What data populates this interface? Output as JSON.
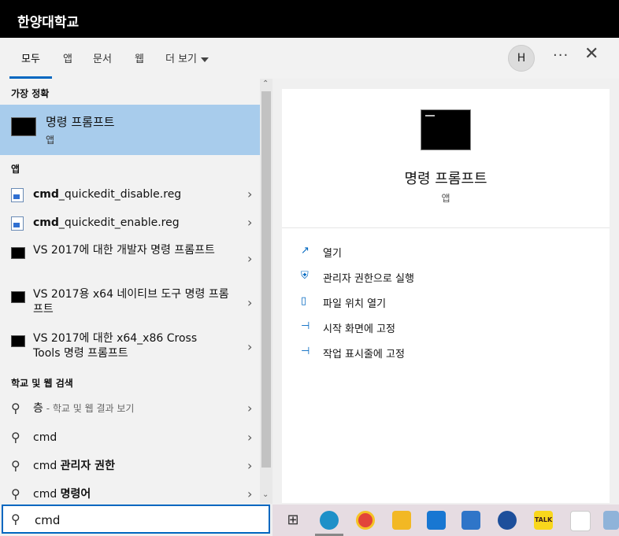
{
  "window": {
    "title": "한양대학교"
  },
  "tabs": [
    "모두",
    "앱",
    "문서",
    "웹",
    "더 보기"
  ],
  "avatar_letter": "H",
  "more_glyph": "···",
  "close_glyph": "✕",
  "sections": {
    "best": "가장 정확",
    "apps": "앱",
    "web": "학교 및 웹 검색"
  },
  "best_match": {
    "name": "명령 프롬프트",
    "type": "앱"
  },
  "apps": [
    {
      "bold": "cmd",
      "rest": "_quickedit_disable.reg"
    },
    {
      "bold": "cmd",
      "rest": "_quickedit_enable.reg"
    },
    {
      "label": "VS 2017에 대한 개발자 명령 프롬프트"
    },
    {
      "label": "VS 2017용 x64 네이티브 도구 명령 프롬프트"
    },
    {
      "label": "VS 2017에 대한 x64_x86 Cross Tools 명령 프롬프트"
    }
  ],
  "web": [
    {
      "main": "층",
      "sub": " - 학교 및 웹 결과 보기"
    },
    {
      "main": "cmd",
      "sub": ""
    },
    {
      "main": "cmd ",
      "bold": "관리자 권한"
    },
    {
      "main": "cmd ",
      "bold": "명령어"
    }
  ],
  "detail": {
    "title": "명령 프롬프트",
    "type": "앱",
    "actions": [
      "열기",
      "관리자 권한으로 실행",
      "파일 위치 열기",
      "시작 화면에 고정",
      "작업 표시줄에 고정"
    ]
  },
  "search": {
    "value": "cmd"
  },
  "taskbar_icons": [
    "task-view-icon",
    "edge-icon",
    "chrome-icon",
    "file-explorer-icon",
    "mail-icon",
    "store-icon",
    "app-icon",
    "kakaotalk-icon",
    "other-app-icon",
    "photos-icon"
  ],
  "taskbar_labels": {
    "task_view": "⊞",
    "kakao": "TALK"
  },
  "colors": {
    "accent": "#0067c0",
    "selected": "#a8ccec",
    "titlebar": "#000000"
  }
}
